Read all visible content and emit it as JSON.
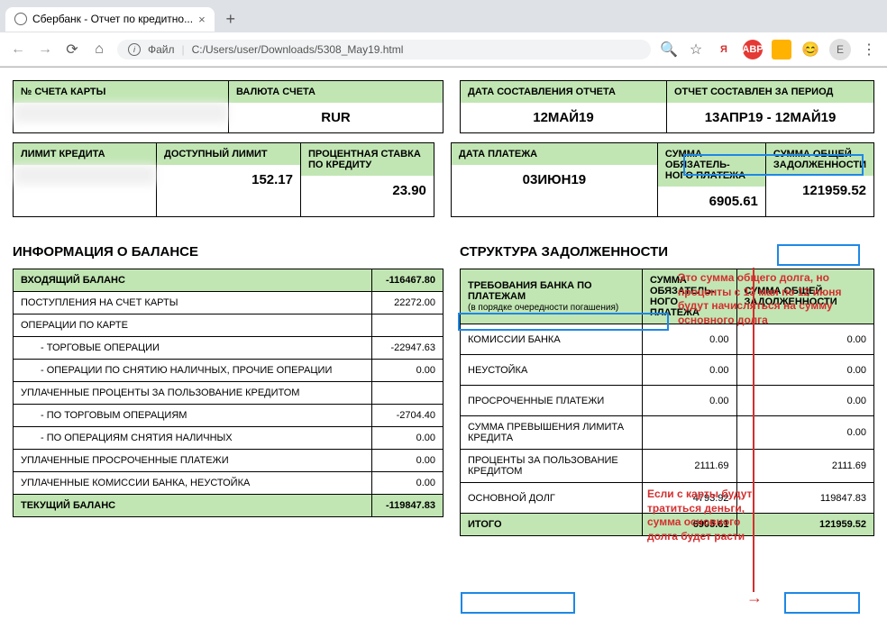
{
  "browser": {
    "tab_title": "Сбербанк - Отчет по кредитно...",
    "file_label": "Файл",
    "url": "C:/Users/user/Downloads/5308_May19.html",
    "avatar_letter": "E"
  },
  "headers": {
    "card_num": "№ СЧЕТА КАРТЫ",
    "currency": "ВАЛЮТА СЧЕТА",
    "report_date": "ДАТА СОСТАВЛЕНИЯ ОТЧЕТА",
    "report_period": "ОТЧЕТ СОСТАВЛЕН ЗА ПЕРИОД",
    "credit_limit": "ЛИМИТ КРЕДИТА",
    "avail_limit": "ДОСТУПНЫЙ ЛИМИТ",
    "rate": "ПРОЦЕНТНАЯ СТАВКА ПО КРЕДИТУ",
    "pay_date": "ДАТА ПЛАТЕЖА",
    "mand_pay": "СУММА ОБЯЗАТЕЛЬ-\nНОГО ПЛАТЕЖА",
    "total_debt": "СУММА ОБЩЕЙ ЗАДОЛЖЕННОСТИ"
  },
  "values": {
    "currency": "RUR",
    "report_date": "12МАЙ19",
    "report_period": "13АПР19 - 12МАЙ19",
    "avail_limit": "152.17",
    "rate": "23.90",
    "pay_date": "03ИЮН19",
    "mand_pay": "6905.61",
    "total_debt": "121959.52"
  },
  "balance": {
    "title": "ИНФОРМАЦИЯ О БАЛАНСЕ",
    "rows": [
      {
        "label": "ВХОДЯЩИЙ БАЛАНС",
        "value": "-116467.80",
        "header": true
      },
      {
        "label": "ПОСТУПЛЕНИЯ НА СЧЕТ КАРТЫ",
        "value": "22272.00"
      },
      {
        "label": "ОПЕРАЦИИ ПО КАРТЕ",
        "value": ""
      },
      {
        "label": "- ТОРГОВЫЕ ОПЕРАЦИИ",
        "value": "-22947.63",
        "indent": true
      },
      {
        "label": "- ОПЕРАЦИИ ПО СНЯТИЮ НАЛИЧНЫХ, ПРОЧИЕ ОПЕРАЦИИ",
        "value": "0.00",
        "indent": true
      },
      {
        "label": "УПЛАЧЕННЫЕ ПРОЦЕНТЫ ЗА ПОЛЬЗОВАНИЕ КРЕДИТОМ",
        "value": ""
      },
      {
        "label": "- ПО ТОРГОВЫМ ОПЕРАЦИЯМ",
        "value": "-2704.40",
        "indent": true
      },
      {
        "label": "- ПО ОПЕРАЦИЯМ СНЯТИЯ НАЛИЧНЫХ",
        "value": "0.00",
        "indent": true
      },
      {
        "label": "УПЛАЧЕННЫЕ ПРОСРОЧЕННЫЕ ПЛАТЕЖИ",
        "value": "0.00"
      },
      {
        "label": "УПЛАЧЕННЫЕ КОМИССИИ БАНКА, НЕУСТОЙКА",
        "value": "0.00"
      },
      {
        "label": "ТЕКУЩИЙ БАЛАНС",
        "value": "-119847.83",
        "header": true
      }
    ]
  },
  "debt": {
    "title": "СТРУКТУРА ЗАДОЛЖЕННОСТИ",
    "col1": "ТРЕБОВАНИЯ БАНКА ПО ПЛАТЕЖАМ",
    "col1_note": "(в порядке очередности погашения)",
    "col2": "СУММА ОБЯЗАТЕЛЬ-\nНОГО ПЛАТЕЖА",
    "col3": "СУММА ОБЩЕЙ ЗАДОЛЖЕННОСТИ",
    "rows": [
      {
        "label": "КОМИССИИ БАНКА",
        "v1": "0.00",
        "v2": "0.00"
      },
      {
        "label": "НЕУСТОЙКА",
        "v1": "0.00",
        "v2": "0.00"
      },
      {
        "label": "ПРОСРОЧЕННЫЕ ПЛАТЕЖИ",
        "v1": "0.00",
        "v2": "0.00"
      },
      {
        "label": "СУММА ПРЕВЫШЕНИЯ ЛИМИТА КРЕДИТА",
        "v1": "",
        "v2": "0.00"
      },
      {
        "label": "ПРОЦЕНТЫ ЗА ПОЛЬЗОВАНИЕ КРЕДИТОМ",
        "v1": "2111.69",
        "v2": "2111.69"
      },
      {
        "label": "ОСНОВНОЙ ДОЛГ",
        "v1": "4793.92",
        "v2": "119847.83"
      }
    ],
    "total_label": "ИТОГО",
    "total_v1": "6905.61",
    "total_v2": "121959.52"
  },
  "annotations": {
    "note1": "Это сумма общего долга, но проценты с 13 мая по 12 июня будут начисляться на сумму основного долга",
    "note2": "Если с карты будут тратиться деньги, сумма основного долга будет расти"
  }
}
